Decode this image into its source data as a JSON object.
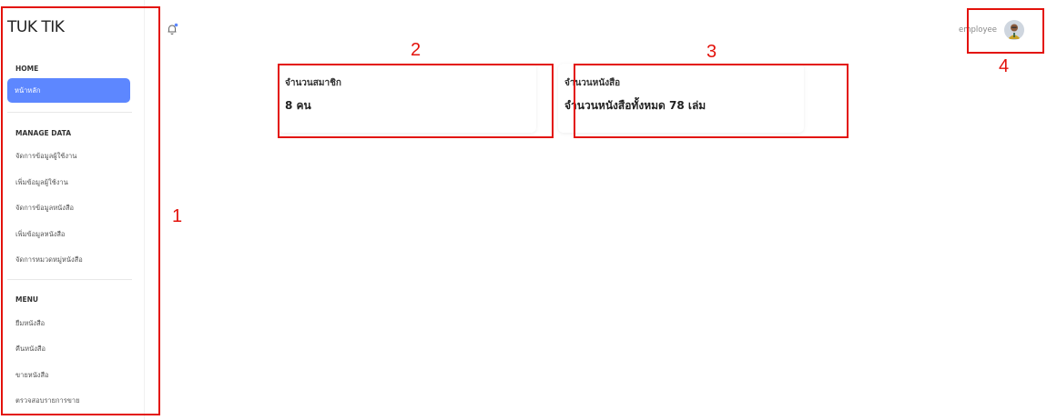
{
  "brand": "TUK TIK",
  "sidebar": {
    "home_section": "HOME",
    "home_item": "หน้าหลัก",
    "manage_section": "MANAGE DATA",
    "manage_items": [
      "จัดการข้อมูลผู้ใช้งาน",
      "เพิ่มข้อมูลผู้ใช้งาน",
      "จัดการข้อมูลหนังสือ",
      "เพิ่มข้อมูลหนังสือ",
      "จัดการหมวดหมู่หนังสือ"
    ],
    "menu_section": "MENU",
    "menu_items": [
      "ยืมหนังสือ",
      "คืนหนังสือ",
      "ขายหนังสือ",
      "ตรวจสอบรายการขาย"
    ]
  },
  "topbar": {
    "username": "employee",
    "icon": "bell-icon",
    "avatar": "avatar"
  },
  "cards": [
    {
      "title": "จำนวนสมาชิก",
      "value": "8 คน"
    },
    {
      "title": "จำนวนหนังสือ",
      "value": "จำนวนหนังสือทั้งหมด 78 เล่ม"
    }
  ],
  "annotations": [
    "1",
    "2",
    "3",
    "4"
  ],
  "colors": {
    "accent": "#5d87ff",
    "annotation": "#e3120b"
  }
}
